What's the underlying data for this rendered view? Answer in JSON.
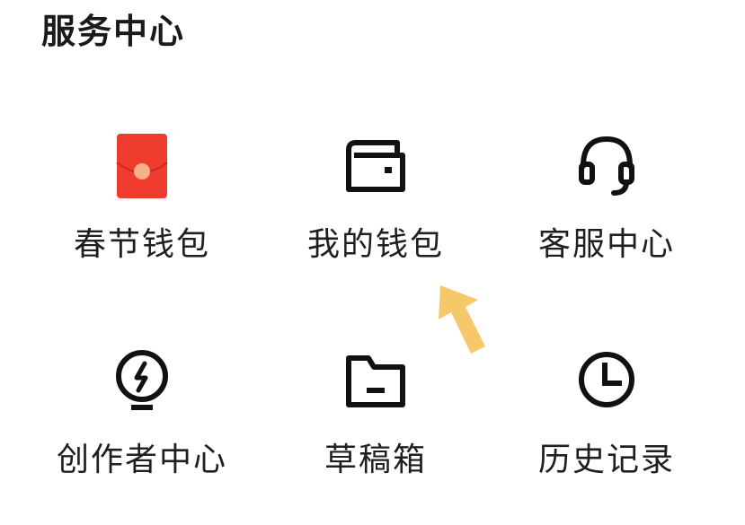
{
  "section": {
    "title": "服务中心"
  },
  "items": [
    {
      "label": "春节钱包",
      "icon": "red-envelope-icon"
    },
    {
      "label": "我的钱包",
      "icon": "wallet-icon"
    },
    {
      "label": "客服中心",
      "icon": "headset-icon"
    },
    {
      "label": "创作者中心",
      "icon": "lightning-bulb-icon"
    },
    {
      "label": "草稿箱",
      "icon": "folder-icon"
    },
    {
      "label": "历史记录",
      "icon": "clock-icon"
    }
  ],
  "colors": {
    "envelope_red": "#f03c2e",
    "envelope_seal": "#f7b08a",
    "icon_stroke": "#111111",
    "arrow": "#f7c86a"
  }
}
